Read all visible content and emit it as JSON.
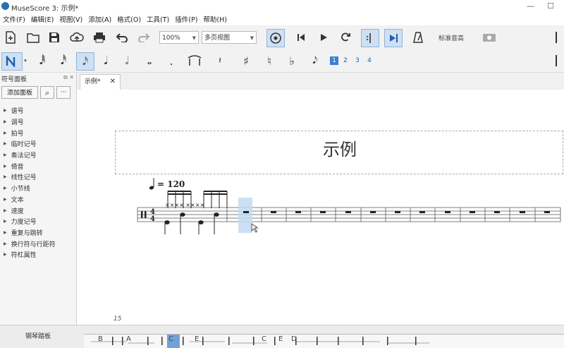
{
  "window": {
    "title": "MuseScore 3: 示例*",
    "minimize": "—",
    "maximize": "☐"
  },
  "menu": [
    "文件(F)",
    "编辑(E)",
    "视图(V)",
    "添加(A)",
    "格式(O)",
    "工具(T)",
    "插件(P)",
    "帮助(H)"
  ],
  "toolbar": {
    "zoom_value": "100%",
    "view_mode": "多页视图",
    "concert_pitch_label": "标准音高"
  },
  "note_input": {
    "voices": [
      "1",
      "2",
      "3",
      "4"
    ],
    "active_voice": "1"
  },
  "palette": {
    "title": "符号面板",
    "add_button": "添加面板",
    "items": [
      "谱号",
      "调号",
      "拍号",
      "临时记号",
      "奏法记号",
      "倚音",
      "线性记号",
      "小节线",
      "文本",
      "速度",
      "力度记号",
      "重复与跳转",
      "换行符与行距符",
      "符杠属性"
    ]
  },
  "tabs": [
    {
      "label": "示例*"
    }
  ],
  "score": {
    "title": "示例",
    "tempo_text": "= 120",
    "time_signature": {
      "numerator": "4",
      "denominator": "4"
    },
    "page_number": "15"
  },
  "mixer": {
    "title": "钢琴踏板",
    "key_labels": [
      "B",
      "A",
      "C",
      "E",
      "C",
      "E",
      "D"
    ]
  },
  "colors": {
    "accent": "#3b7fd0",
    "selection": "#cfe0f2",
    "measure_selection": "#c3daf2"
  }
}
